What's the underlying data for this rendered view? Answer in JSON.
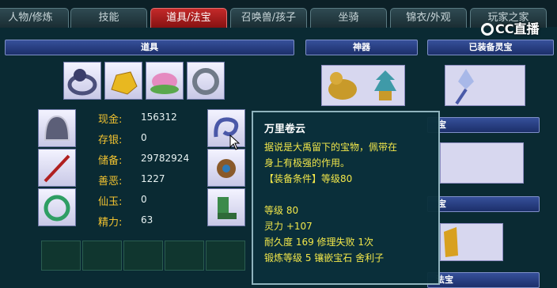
{
  "tabs": [
    {
      "label": "人物/修炼"
    },
    {
      "label": "技能"
    },
    {
      "label": "道具/法宝"
    },
    {
      "label": "召唤兽/孩子"
    },
    {
      "label": "坐骑"
    },
    {
      "label": "锦衣/外观"
    },
    {
      "label": "玩家之家"
    }
  ],
  "logo": "CC直播",
  "headers": {
    "items": "道具",
    "artifact": "神器",
    "spirit": "已装备灵宝"
  },
  "stats": [
    {
      "label": "现金:",
      "value": "156312"
    },
    {
      "label": "存银:",
      "value": "0"
    },
    {
      "label": "储备:",
      "value": "29782924"
    },
    {
      "label": "善恶:",
      "value": "1227"
    },
    {
      "label": "仙玉:",
      "value": "0"
    },
    {
      "label": "精力:",
      "value": "63"
    }
  ],
  "tooltip": {
    "title": "万里卷云",
    "desc1": "据说是大禹留下的宝物，佩带在",
    "desc2": "身上有极强的作用。",
    "req": "【装备条件】等级80",
    "lines": [
      "等级 80",
      "灵力 +107",
      "耐久度 169 修理失败 1次",
      "锻炼等级 5 镶嵌宝石 舍利子"
    ]
  },
  "side_bars": {
    "b1": "宝",
    "b2": "宝",
    "b3": "法宝"
  },
  "colors": {
    "active_tab": "#c42a2a",
    "tooltip_text": "#f2e74a",
    "stat_label": "#f1c230"
  }
}
